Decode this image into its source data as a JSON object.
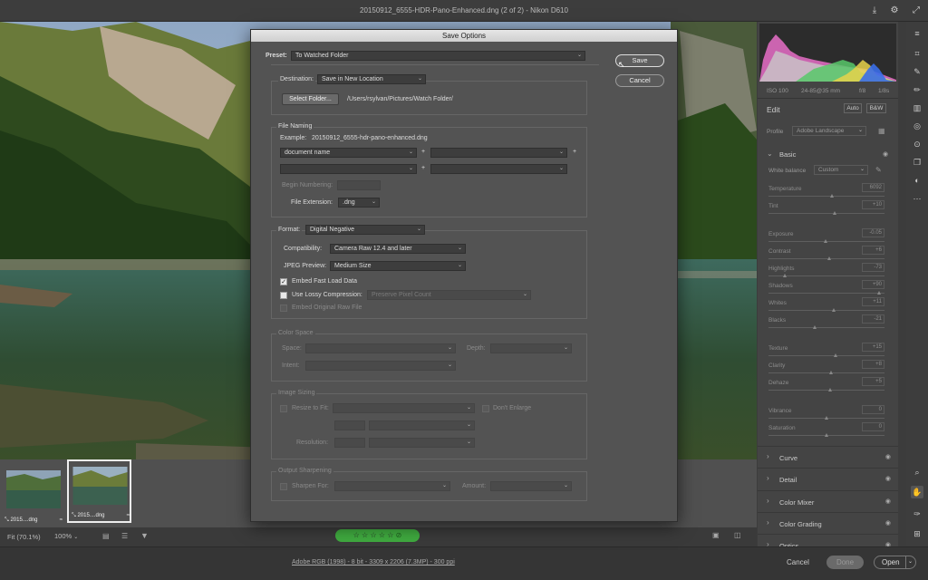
{
  "app": {
    "title": "20150912_6555-HDR-Pano-Enhanced.dng (2 of 2)  -  Nikon D610"
  },
  "histogram": {
    "meta": [
      "ISO 100",
      "24-85@35 mm",
      "f/8",
      "1/8s"
    ]
  },
  "edit": {
    "title": "Edit",
    "auto": "Auto",
    "bw": "B&W",
    "profile_label": "Profile",
    "profile_value": "Adobe Landscape",
    "basic": "Basic",
    "wb_label": "White balance",
    "wb_value": "Custom",
    "sliders": [
      {
        "name": "Temperature",
        "value": "6092",
        "pos": 0.55
      },
      {
        "name": "Tint",
        "value": "+10",
        "pos": 0.57
      },
      {
        "name": "Exposure",
        "value": "-0.05",
        "pos": 0.49
      },
      {
        "name": "Contrast",
        "value": "+6",
        "pos": 0.52
      },
      {
        "name": "Highlights",
        "value": "-73",
        "pos": 0.14
      },
      {
        "name": "Shadows",
        "value": "+90",
        "pos": 0.95
      },
      {
        "name": "Whites",
        "value": "+11",
        "pos": 0.56
      },
      {
        "name": "Blacks",
        "value": "-21",
        "pos": 0.4
      },
      {
        "name": "Texture",
        "value": "+15",
        "pos": 0.58
      },
      {
        "name": "Clarity",
        "value": "+8",
        "pos": 0.54
      },
      {
        "name": "Dehaze",
        "value": "+5",
        "pos": 0.53
      },
      {
        "name": "Vibrance",
        "value": "0",
        "pos": 0.5
      },
      {
        "name": "Saturation",
        "value": "0",
        "pos": 0.5
      }
    ],
    "sections": [
      "Curve",
      "Detail",
      "Color Mixer",
      "Color Grading",
      "Optics"
    ]
  },
  "filmstrip": {
    "items": [
      "2015....dng",
      "2015....dng"
    ]
  },
  "bottombar": {
    "fit": "Fit (70.1%)",
    "zoom": "100%"
  },
  "status": {
    "info": "Adobe RGB (1998) - 8 bit - 3309 x 2206 (7.3MP) - 300 ppi",
    "cancel": "Cancel",
    "done": "Done",
    "open": "Open"
  },
  "dialog": {
    "title": "Save Options",
    "save": "Save",
    "cancel": "Cancel",
    "preset_label": "Preset:",
    "preset_value": "To Watched Folder",
    "destination_label": "Destination:",
    "destination_value": "Save in New Location",
    "select_folder": "Select Folder...",
    "folder_path": "/Users/rsylvan/Pictures/Watch Folder/",
    "file_naming": {
      "title": "File Naming",
      "example_label": "Example:",
      "example_value": "20150912_6555-hdr-pano-enhanced.dng",
      "field1": "document name",
      "plus": "+",
      "begin_numbering": "Begin Numbering:",
      "ext_label": "File Extension:",
      "ext_value": ".dng"
    },
    "format": {
      "label": "Format:",
      "value": "Digital Negative",
      "compat_label": "Compatibility:",
      "compat_value": "Camera Raw 12.4 and later",
      "jpeg_label": "JPEG Preview:",
      "jpeg_value": "Medium Size",
      "embed_fast": "Embed Fast Load Data",
      "lossy": "Use Lossy Compression:",
      "lossy_value": "Preserve Pixel Count",
      "embed_raw": "Embed Original Raw File"
    },
    "color_space": {
      "title": "Color Space",
      "space": "Space:",
      "depth": "Depth:",
      "intent": "Intent:"
    },
    "sizing": {
      "title": "Image Sizing",
      "resize": "Resize to Fit:",
      "dont_enlarge": "Don't Enlarge",
      "resolution": "Resolution:"
    },
    "sharpening": {
      "title": "Output Sharpening",
      "sharpen": "Sharpen For:",
      "amount": "Amount:"
    }
  },
  "colors": {
    "accent_green": "#3fa93f",
    "dialog_bg": "#535353",
    "panel_bg": "#444444"
  }
}
